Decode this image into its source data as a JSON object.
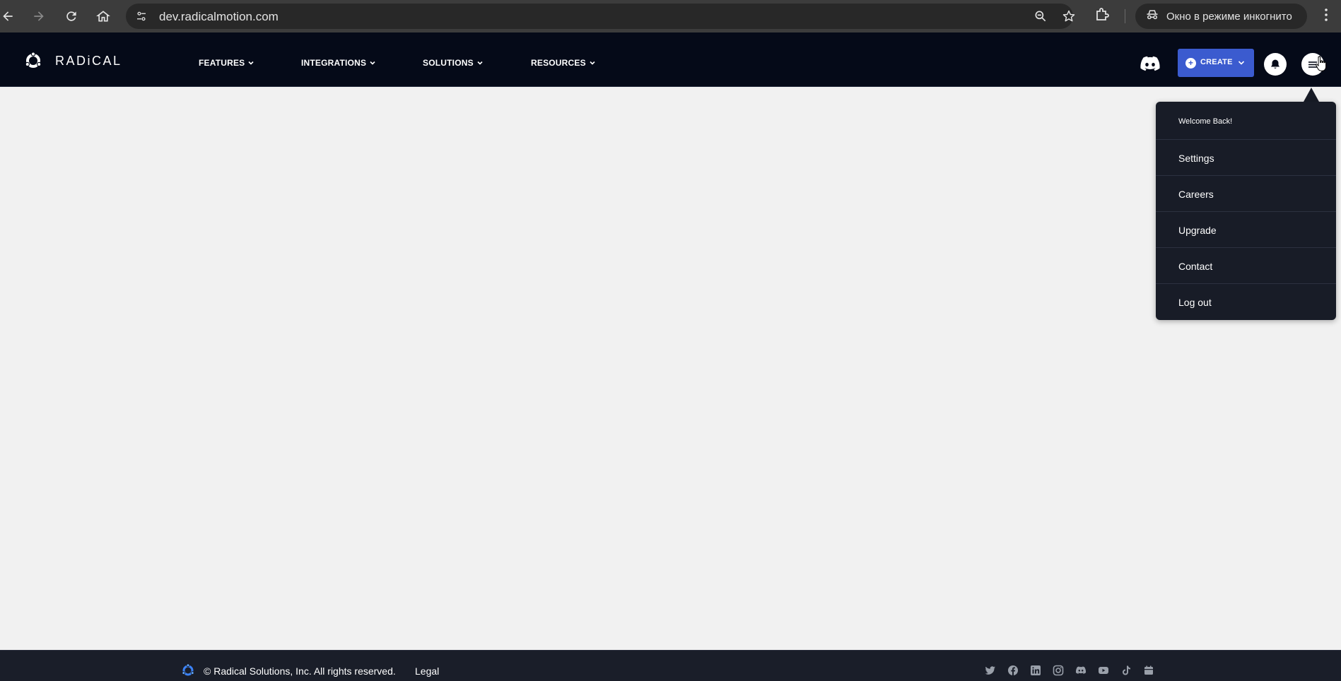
{
  "browser": {
    "url": "dev.radicalmotion.com",
    "incognito_label": "Окно в режиме инкогнито",
    "icons": [
      "back-icon",
      "forward-icon",
      "reload-icon",
      "home-icon",
      "site-info-icon",
      "zoom-icon",
      "bookmark-star-icon",
      "extensions-icon",
      "incognito-icon",
      "more-icon"
    ]
  },
  "header": {
    "logo_text": "RADiCAL",
    "nav": [
      {
        "label": "FEATURES"
      },
      {
        "label": "INTEGRATIONS"
      },
      {
        "label": "SOLUTIONS"
      },
      {
        "label": "RESOURCES"
      }
    ],
    "create_label": "CREATE",
    "accent": "#3b5bcf"
  },
  "user_menu": {
    "greeting": "Welcome Back!",
    "items": [
      {
        "label": "Settings"
      },
      {
        "label": "Careers"
      },
      {
        "label": "Upgrade"
      },
      {
        "label": "Contact"
      },
      {
        "label": "Log out"
      }
    ]
  },
  "footer": {
    "copyright": "© Radical Solutions, Inc. All rights reserved.",
    "legal": "Legal",
    "social": [
      "twitter-icon",
      "facebook-icon",
      "linkedin-icon",
      "instagram-icon",
      "discord-icon",
      "youtube-icon",
      "tiktok-icon",
      "calendar-icon"
    ]
  }
}
